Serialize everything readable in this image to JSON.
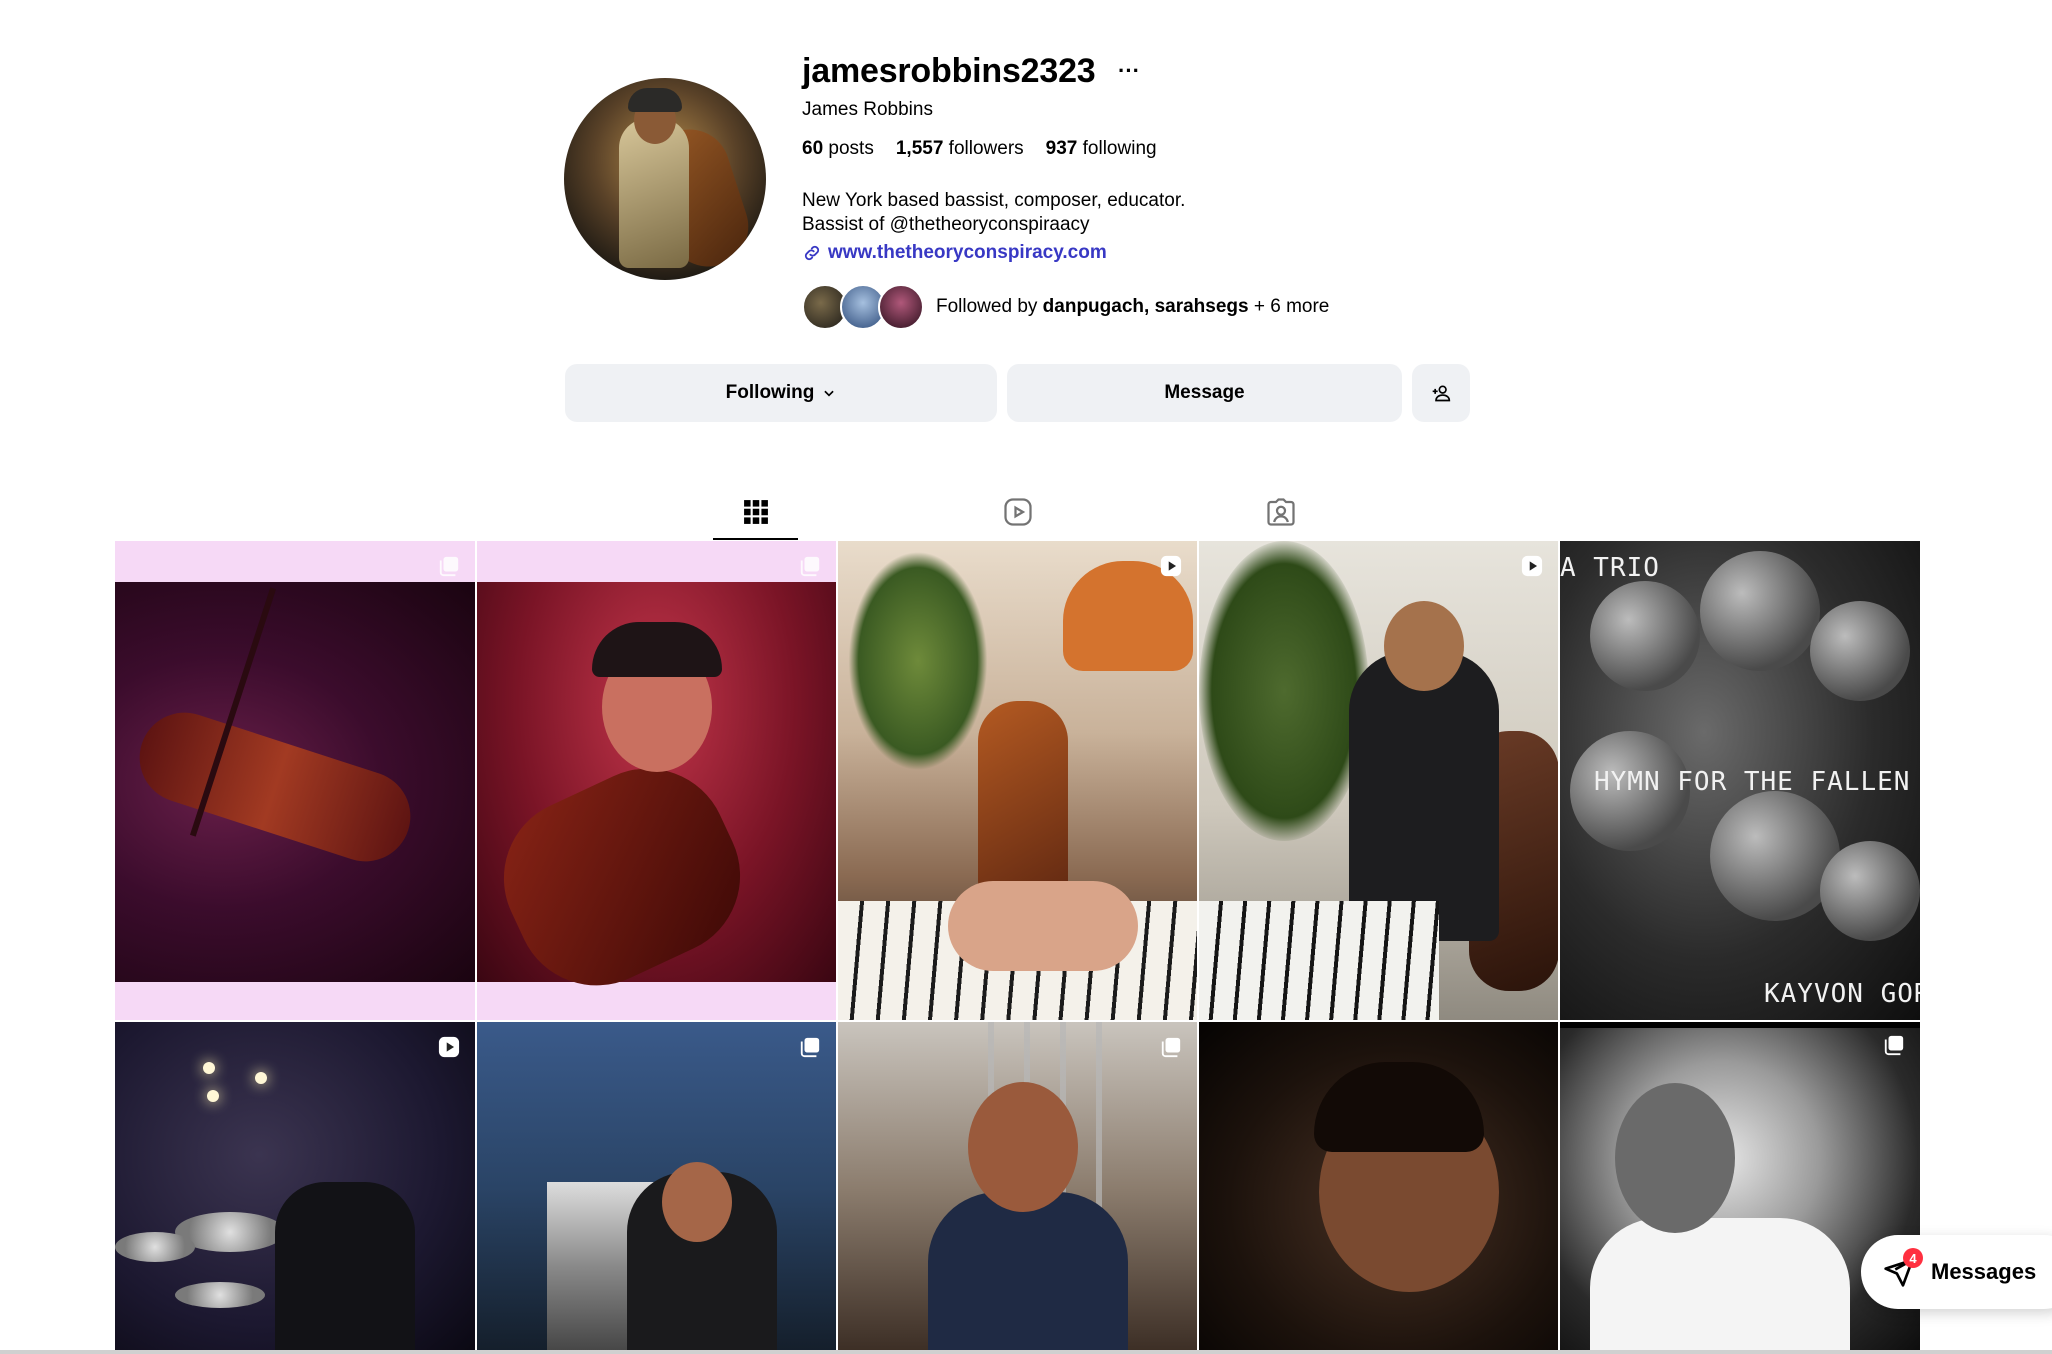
{
  "profile": {
    "username": "jamesrobbins2323",
    "full_name": "James Robbins",
    "stats": {
      "posts_count": "60",
      "posts_label": "posts",
      "followers_count": "1,557",
      "followers_label": "followers",
      "following_count": "937",
      "following_label": "following"
    },
    "bio_line1": "New York based bassist, composer, educator.",
    "bio_line2": "Bassist of @thetheoryconspiraacy",
    "website": "www.thetheoryconspiracy.com",
    "followed_by": {
      "prefix": "Followed by",
      "names": "danpugach, sarahsegs",
      "suffix": "+ 6 more"
    }
  },
  "actions": {
    "following_label": "Following",
    "message_label": "Message"
  },
  "tabs": [
    "posts-grid",
    "reels",
    "tagged"
  ],
  "posts": {
    "post5_text_top": "A TRIO",
    "post5_text_middle": "HYMN FOR THE FALLEN",
    "post5_text_bottom": "KAYVON GORI"
  },
  "messages": {
    "label": "Messages",
    "unread_count": "4"
  },
  "icons": [
    "more-icon",
    "link-icon",
    "chevron-down-icon",
    "add-user-icon",
    "grid-icon",
    "reels-icon",
    "tagged-icon",
    "reel-badge-icon",
    "carousel-badge-icon",
    "messages-icon"
  ],
  "colors": {
    "link": "#3838c4",
    "button_bg": "#eff1f4",
    "badge_red": "#ff3040"
  }
}
